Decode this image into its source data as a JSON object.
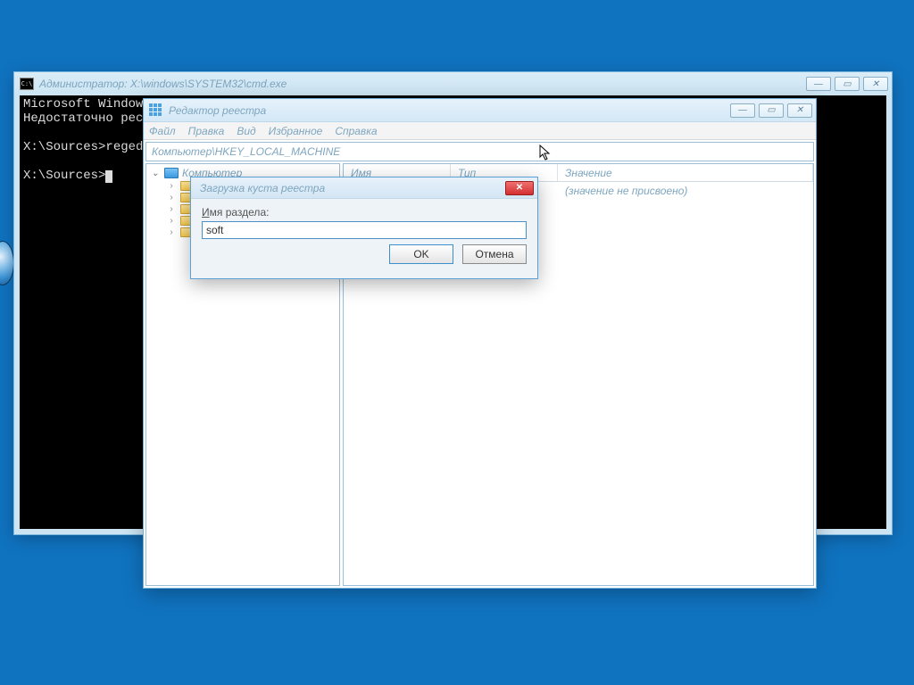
{
  "cmd": {
    "title": "Администратор: X:\\windows\\SYSTEM32\\cmd.exe",
    "icon_text": "C:\\",
    "line1": "Microsoft Windows",
    "line2": "Недостаточно ресу",
    "line3": "X:\\Sources>regedi",
    "line4": "X:\\Sources>"
  },
  "regedit": {
    "title": "Редактор реестра",
    "menu": {
      "file": "Файл",
      "edit": "Правка",
      "view": "Вид",
      "fav": "Избранное",
      "help": "Справка"
    },
    "address": "Компьютер\\HKEY_LOCAL_MACHINE",
    "tree": {
      "root": "Компьютер"
    },
    "columns": {
      "name": "Имя",
      "type": "Тип",
      "value": "Значение"
    },
    "row_value": "(значение не присвоено)"
  },
  "dialog": {
    "title": "Загрузка куста реестра",
    "label_prefix": "И",
    "label_rest": "мя раздела:",
    "input_value": "soft",
    "ok": "OK",
    "cancel": "Отмена"
  },
  "winbtn": {
    "min": "—",
    "max": "▭",
    "close": "✕"
  }
}
